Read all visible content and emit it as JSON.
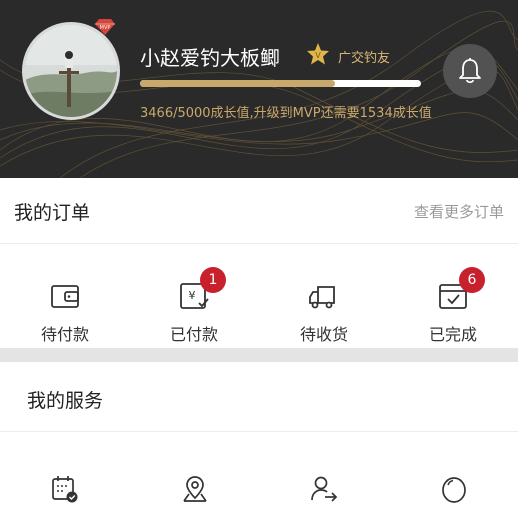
{
  "profile": {
    "username": "小赵爱钓大板鲫",
    "level_name": "广交钓友",
    "growth_text": "3466/5000成长值,升级到MVP还需要1534成长值",
    "growth_current": 3466,
    "growth_target": 5000,
    "vip_badge": "MVP"
  },
  "orders": {
    "title": "我的订单",
    "more_label": "查看更多订单",
    "items": [
      {
        "label": "待付款",
        "icon": "wallet-icon",
        "badge": ""
      },
      {
        "label": "已付款",
        "icon": "paid-receipt-icon",
        "badge": "1"
      },
      {
        "label": "待收货",
        "icon": "delivery-truck-icon",
        "badge": ""
      },
      {
        "label": "已完成",
        "icon": "completed-calendar-icon",
        "badge": "6"
      }
    ]
  },
  "services": {
    "title": "我的服务",
    "items": [
      {
        "icon": "calendar-check-icon"
      },
      {
        "icon": "map-pin-icon"
      },
      {
        "icon": "user-transfer-icon"
      },
      {
        "icon": "egg-icon"
      }
    ]
  },
  "colors": {
    "header_bg": "#2a2a2a",
    "gold": "#c9a86c",
    "badge_red": "#c8202d"
  }
}
